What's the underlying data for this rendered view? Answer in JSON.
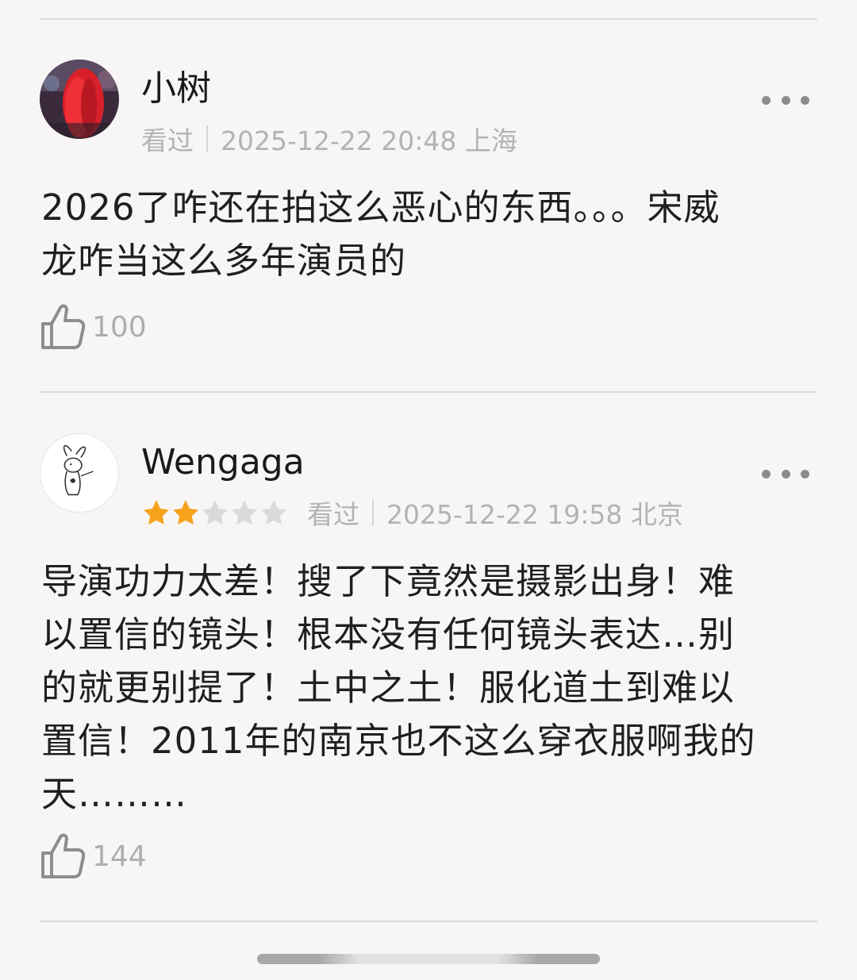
{
  "comments": [
    {
      "username": "小树",
      "status": "看过",
      "datetime_location": "2025-12-22 20:48 上海",
      "rating": null,
      "text": "2026了咋还在拍这么恶心的东西。。。宋威\n龙咋当这么多年演员的",
      "likes": "100",
      "more_icon": "more-dots-icon",
      "like_icon": "thumbs-up-icon"
    },
    {
      "username": "Wengaga",
      "status": "看过",
      "datetime_location": "2025-12-22 19:58 北京",
      "rating": 2,
      "rating_max": 5,
      "text": "导演功力太差！搜了下竟然是摄影出身！难\n以置信的镜头！根本没有任何镜头表达…别\n的就更别提了！土中之土！服化道土到难以\n置信！2011年的南京也不这么穿衣服啊我的\n天………",
      "likes": "144",
      "more_icon": "more-dots-icon",
      "like_icon": "thumbs-up-icon"
    }
  ],
  "colors": {
    "star_filled": "#f7a21b",
    "star_empty": "#dcdad8",
    "meta_text": "#b5b3b1",
    "background": "#f7f6f5"
  }
}
